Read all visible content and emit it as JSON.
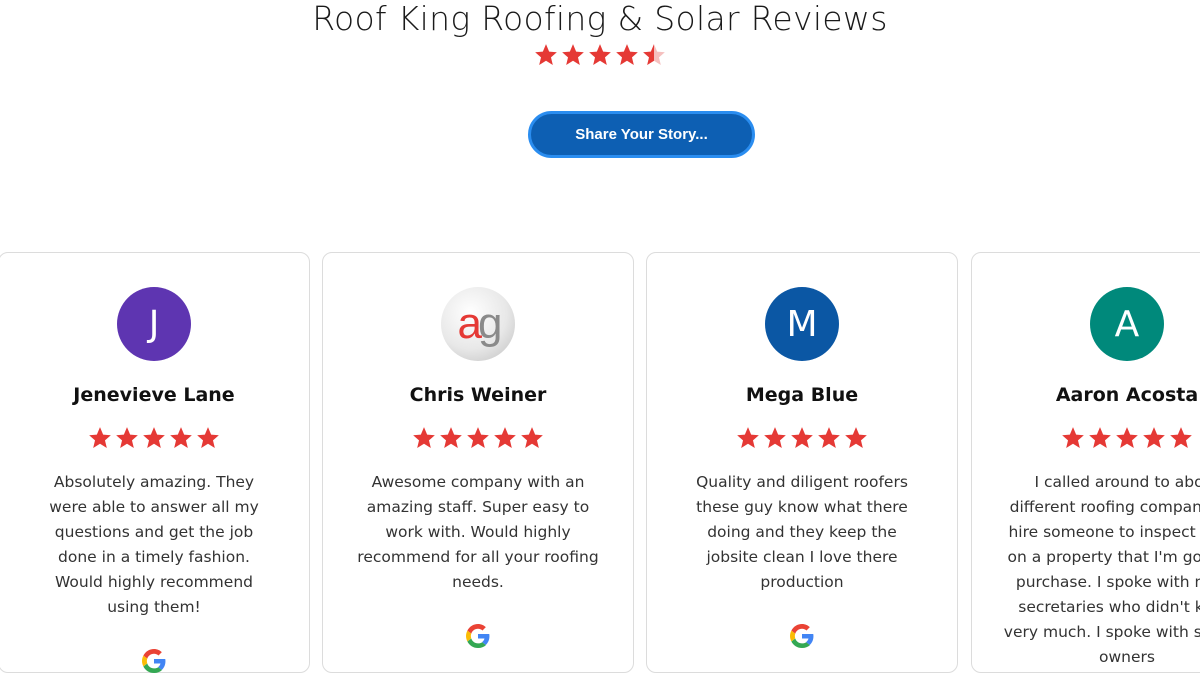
{
  "header": {
    "title": "Roof King Roofing & Solar Reviews",
    "overall_rating": 4.5,
    "star_color": "#e53935"
  },
  "share_button": {
    "label": "Share Your Story..."
  },
  "reviews": [
    {
      "name": "Jenevieve Lane",
      "initial": "J",
      "avatar_color": "#5e35b1",
      "rating": 5,
      "text": "Absolutely amazing. They were able to answer all my questions and get the job done in a timely fashion. Would highly recommend using them!",
      "source_icon": "google-icon"
    },
    {
      "name": "Chris Weiner",
      "initial": "ag",
      "avatar_color": "#e0e0e0",
      "rating": 5,
      "text": "Awesome company with an amazing staff. Super easy to work with. Would highly recommend for all your roofing needs.",
      "source_icon": "google-icon"
    },
    {
      "name": "Mega Blue",
      "initial": "M",
      "avatar_color": "#0b57a4",
      "rating": 5,
      "text": "Quality and diligent roofers these guy know what there doing and they keep the jobsite clean I love there production",
      "source_icon": "google-icon"
    },
    {
      "name": "Aaron Acosta",
      "initial": "A",
      "avatar_color": "#00897b",
      "rating": 5,
      "text": "I called around to about different roofing companies to hire someone to inspect a roof on a property that I'm going to purchase. I spoke with many secretaries who didn't know very much. I spoke with several owners",
      "source_icon": "google-icon"
    }
  ]
}
